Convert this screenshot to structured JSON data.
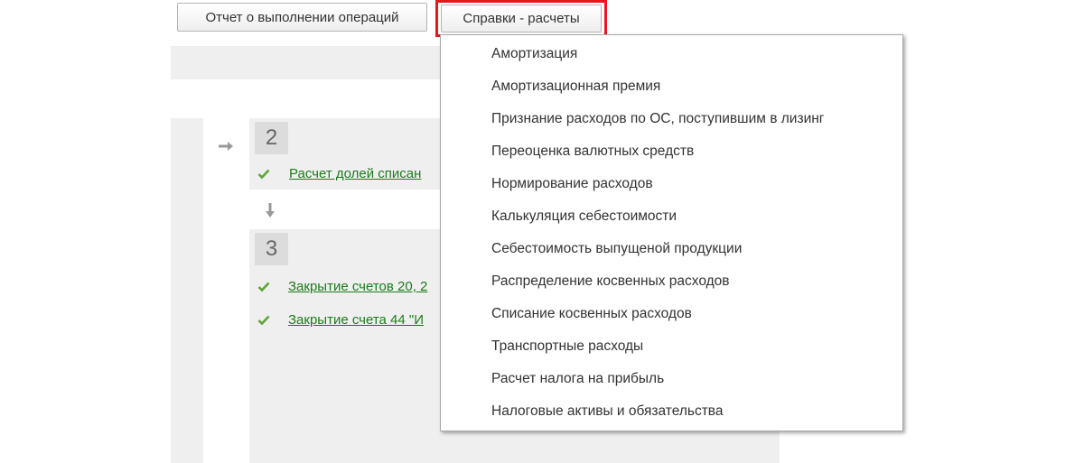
{
  "toolbar": {
    "report_button_label": "Отчет о выполнении операций",
    "reports_button_label": "Справки - расчеты"
  },
  "steps": [
    {
      "number": "2",
      "tasks": [
        "Расчет долей списан"
      ]
    },
    {
      "number": "3",
      "tasks": [
        "Закрытие счетов 20, 2",
        "Закрытие счета 44 \"И"
      ]
    }
  ],
  "menu": {
    "items": [
      "Амортизация",
      "Амортизационная премия",
      "Признание расходов по ОС, поступившим в лизинг",
      "Переоценка валютных средств",
      "Нормирование расходов",
      "Калькуляция себестоимости",
      "Себестоимость выпущеной продукции",
      "Распределение косвенных расходов",
      "Списание косвенных расходов",
      "Транспортные расходы",
      "Расчет налога на прибыль",
      "Налоговые активы и обязательства"
    ]
  },
  "colors": {
    "highlight_frame": "#e8171d",
    "link": "#1b7c1b",
    "check": "#5ea535",
    "panel_bg": "#efefef"
  },
  "icons": {
    "step_arrow_right": "arrow-right-icon",
    "step_arrow_down": "arrow-down-icon",
    "task_done": "checkmark-icon"
  }
}
